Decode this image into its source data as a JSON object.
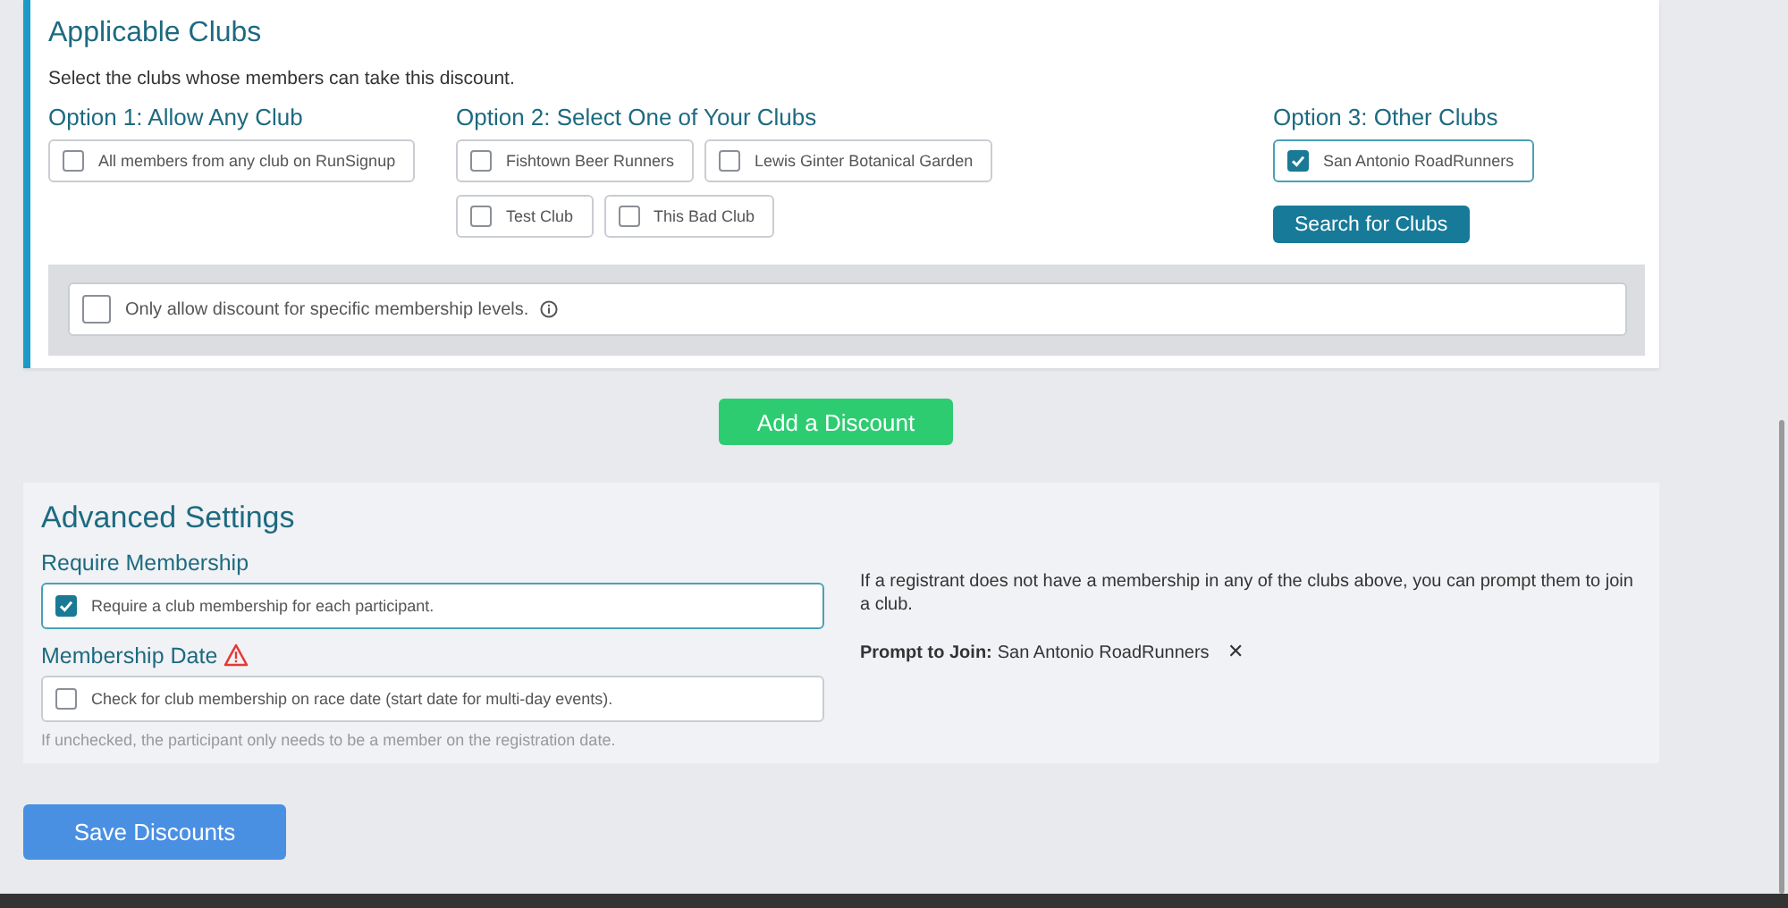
{
  "applicable_clubs": {
    "title": "Applicable Clubs",
    "description": "Select the clubs whose members can take this discount.",
    "options": [
      {
        "heading": "Option 1: Allow Any Club",
        "clubs": [
          {
            "label": "All members from any club on RunSignup",
            "checked": false
          }
        ]
      },
      {
        "heading": "Option 2: Select One of Your Clubs",
        "clubs": [
          {
            "label": "Fishtown Beer Runners",
            "checked": false
          },
          {
            "label": "Lewis Ginter Botanical Garden",
            "checked": false
          },
          {
            "label": "Test Club",
            "checked": false
          },
          {
            "label": "This Bad Club",
            "checked": false
          }
        ]
      },
      {
        "heading": "Option 3: Other Clubs",
        "clubs": [
          {
            "label": "San Antonio RoadRunners",
            "checked": true
          }
        ],
        "button": "Search for Clubs"
      }
    ],
    "membership_levels": {
      "label": "Only allow discount for specific membership levels.",
      "checked": false
    }
  },
  "add_button": "Add a Discount",
  "advanced_settings": {
    "title": "Advanced Settings",
    "require_membership": {
      "heading": "Require Membership",
      "label": "Require a club membership for each participant.",
      "checked": true
    },
    "membership_date": {
      "heading": "Membership Date",
      "label": "Check for club membership on race date (start date for multi-day events).",
      "checked": false,
      "help": "If unchecked, the participant only needs to be a member on the registration date."
    },
    "prompt_info": "If a registrant does not have a membership in any of the clubs above, you can prompt them to join a club.",
    "prompt_to_join": {
      "label": "Prompt to Join:",
      "value": "San Antonio RoadRunners",
      "remove": "✕"
    }
  },
  "save_button": "Save Discounts"
}
